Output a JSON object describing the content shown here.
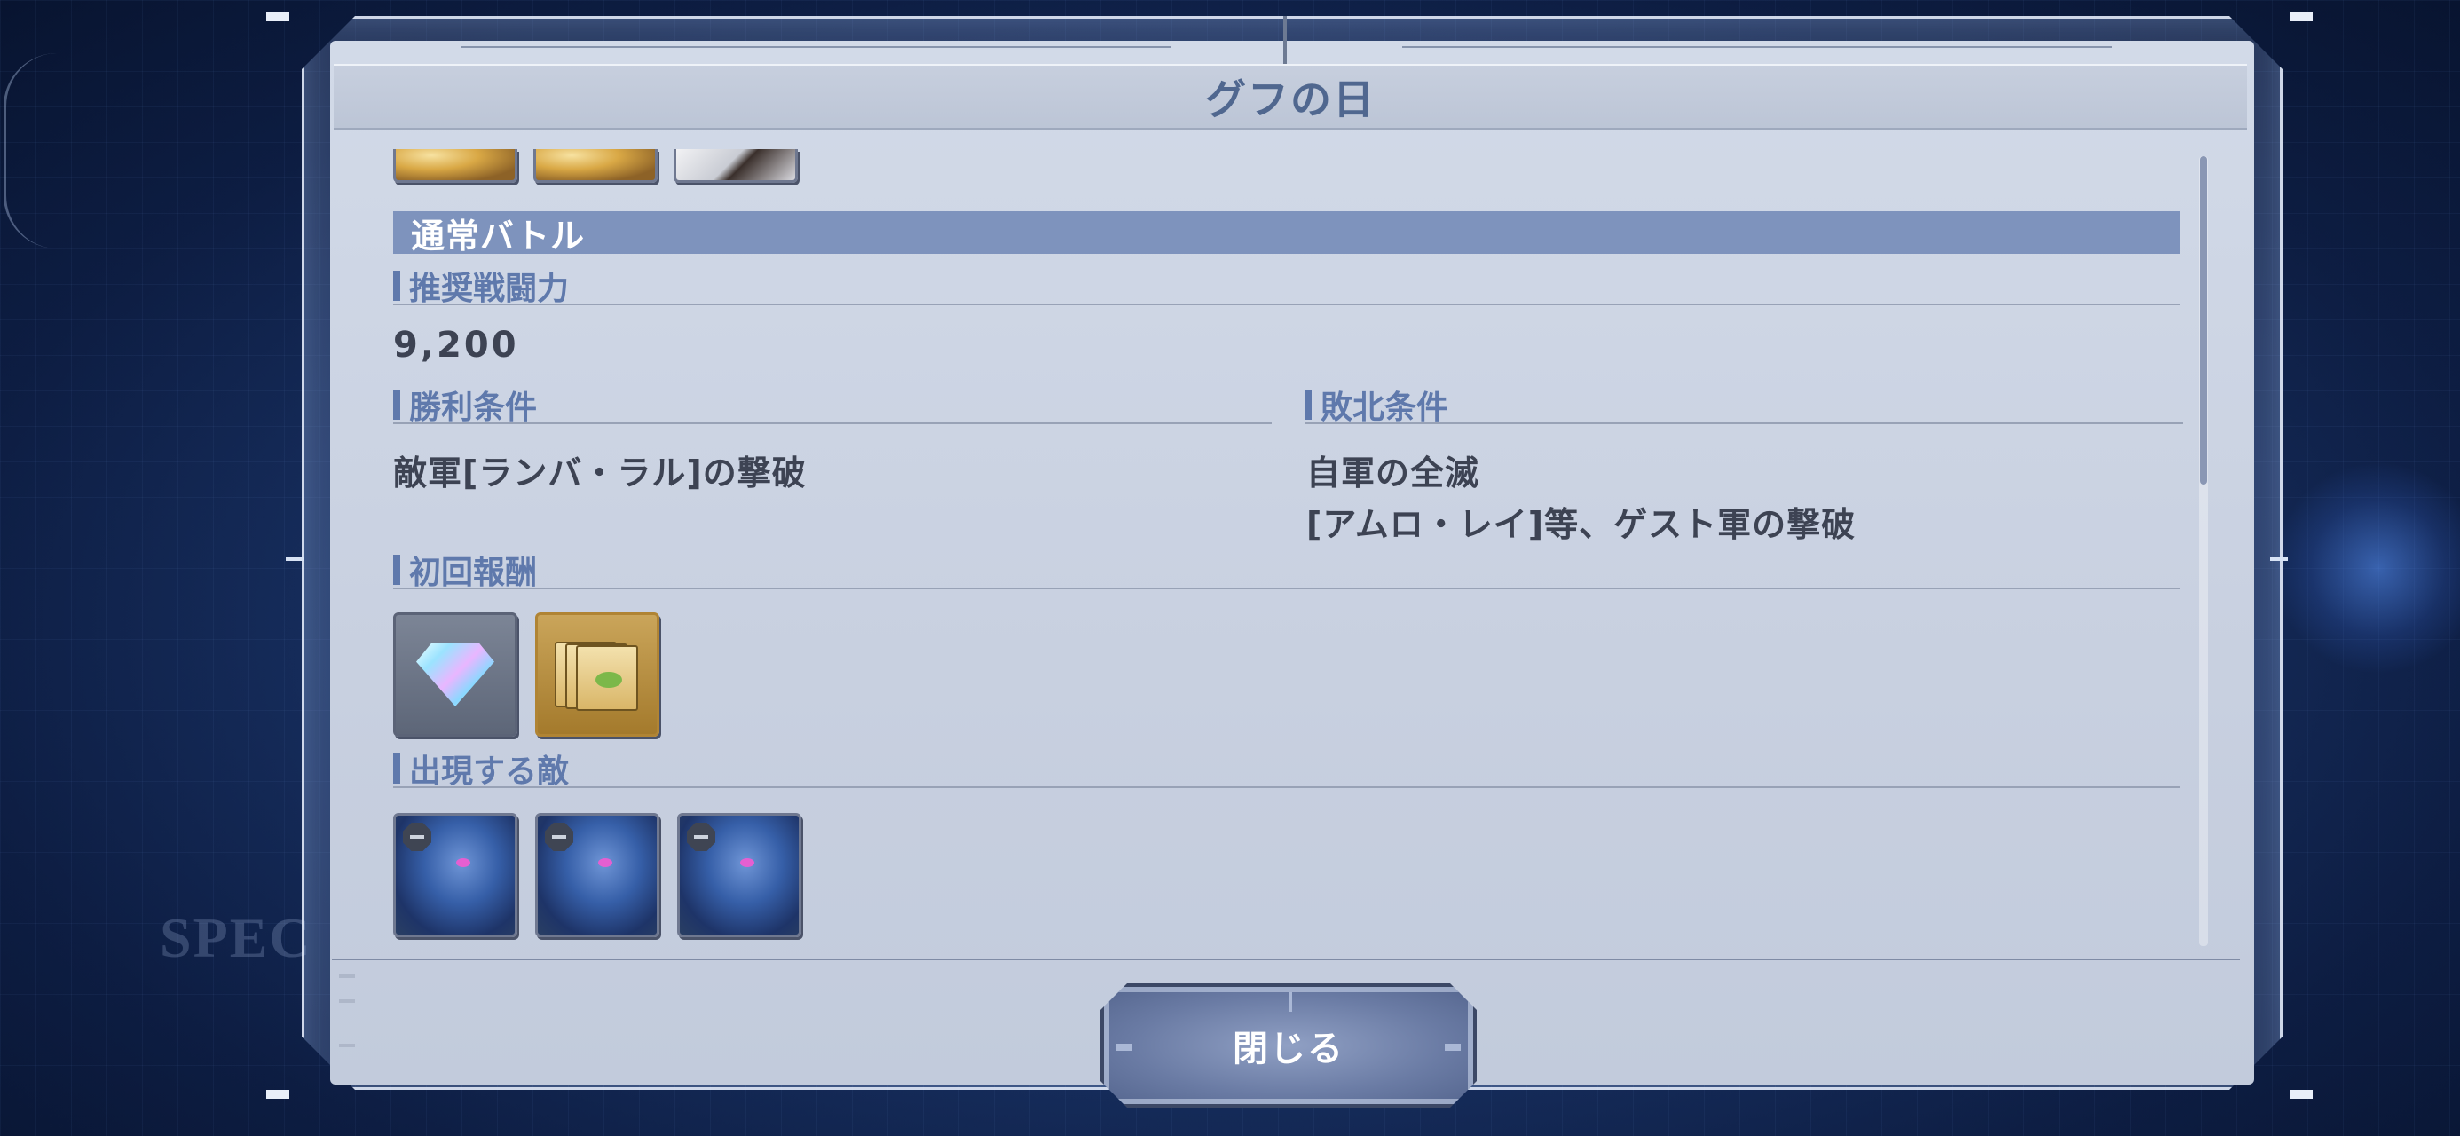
{
  "dialog": {
    "title": "グフの日",
    "close_label": "閉じる"
  },
  "battle": {
    "header": "通常バトル",
    "recommended_power_label": "推奨戦闘力",
    "recommended_power_value": "9,200",
    "win_condition_label": "勝利条件",
    "win_condition_text": "敵軍[ランバ・ラル]の撃破",
    "loss_condition_label": "敗北条件",
    "loss_condition_lines": [
      "自軍の全滅",
      "[アムロ・レイ]等、ゲスト軍の撃破"
    ],
    "first_reward_label": "初回報酬",
    "enemies_label": "出現する敵"
  },
  "background": {
    "partial_text": "SPEC"
  },
  "icons": {
    "first_rewards": [
      "diamond-gem-icon",
      "gold-ticket-icon"
    ],
    "enemies": [
      "gouf-unit-1-icon",
      "gouf-unit-2-icon",
      "gouf-unit-3-icon"
    ],
    "ally_units_partial": [
      "gold-unit-1-icon",
      "gold-unit-2-icon",
      "white-unit-icon"
    ]
  },
  "colors": {
    "panel": "#c8d0e0",
    "accent": "#5f79ac",
    "section_band": "#7e93bd",
    "text": "#3d4353"
  }
}
